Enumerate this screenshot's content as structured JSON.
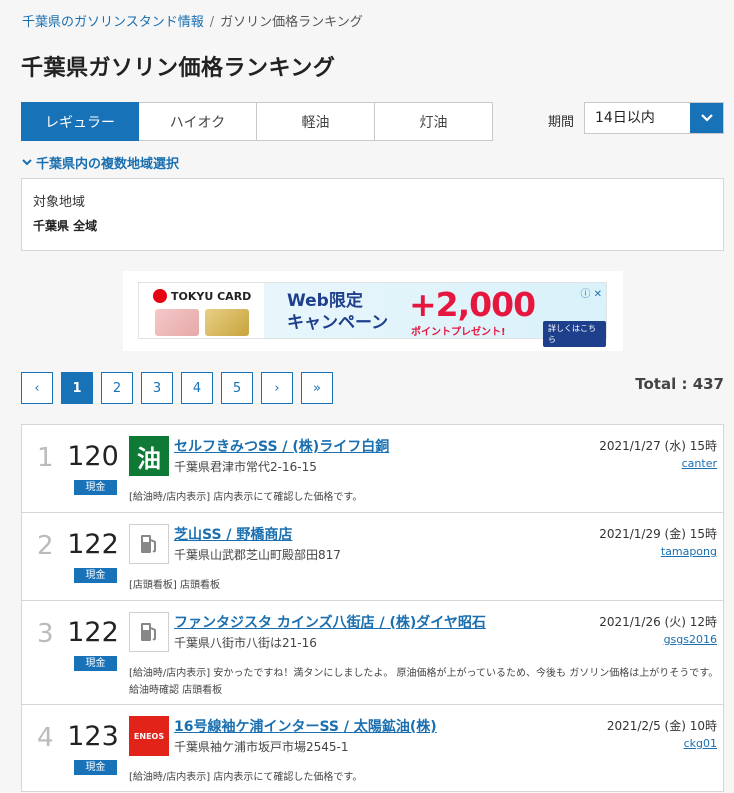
{
  "breadcrumb": {
    "parent": "千葉県のガソリンスタンド情報",
    "separator": "/",
    "current": "ガソリン価格ランキング"
  },
  "page_title": "千葉県ガソリン価格ランキング",
  "tabs": [
    {
      "label": "レギュラー",
      "active": true
    },
    {
      "label": "ハイオク",
      "active": false
    },
    {
      "label": "軽油",
      "active": false
    },
    {
      "label": "灯油",
      "active": false
    }
  ],
  "period": {
    "label": "期間",
    "value": "14日以内"
  },
  "region": {
    "toggle_label": "千葉県内の複数地域選択",
    "box_label": "対象地域",
    "value": "千葉県 全域"
  },
  "ad": {
    "brand": "TOKYU CARD",
    "headline_1": "Web限定",
    "headline_2": "キャンペーン",
    "amount": "+2,000",
    "present": "ポイントプレゼント!",
    "detail": "詳しくはこちら",
    "close": "ⓘ ✕"
  },
  "pager": {
    "prev": "‹",
    "pages": [
      "1",
      "2",
      "3",
      "4",
      "5"
    ],
    "next": "›",
    "last": "»",
    "current_page": 1
  },
  "total": "Total : 437",
  "colors": {
    "accent": "#1772b8",
    "link": "#1a6fb0",
    "eneos_red": "#e2231a"
  },
  "stations": [
    {
      "rank": "1",
      "price": "120",
      "payment": "現金",
      "logo": "abura-kanji-logo",
      "logo_text": "油",
      "name": "セルフきみつSS / (株)ライフ白銅",
      "address": "千葉県君津市常代2-16-15",
      "date": "2021/1/27 (水) 15時",
      "user": "canter",
      "note": "[給油時/店内表示] 店内表示にて確認した価格です。"
    },
    {
      "rank": "2",
      "price": "122",
      "payment": "現金",
      "logo": "fuel-pump-icon",
      "logo_text": "",
      "name": "芝山SS / 野橋商店",
      "address": "千葉県山武郡芝山町殿部田817",
      "date": "2021/1/29 (金) 15時",
      "user": "tamapong",
      "note": "[店頭看板] 店頭看板"
    },
    {
      "rank": "3",
      "price": "122",
      "payment": "現金",
      "logo": "fuel-pump-icon",
      "logo_text": "",
      "name": "ファンタジスタ カインズ八街店 / (株)ダイヤ昭石",
      "address": "千葉県八街市八街は21-16",
      "date": "2021/1/26 (火) 12時",
      "user": "gsgs2016",
      "note": "[給油時/店内表示] 安かったですね！満タンにしましたよ。 原油価格が上がっているため、今後も ガソリン価格は上がりそうです。 給油時確認 店頭看板"
    },
    {
      "rank": "4",
      "price": "123",
      "payment": "現金",
      "logo": "eneos-logo",
      "logo_text": "ENEOS",
      "name": "16号線袖ケ浦インターSS / 太陽鉱油(株)",
      "address": "千葉県袖ケ浦市坂戸市場2545-1",
      "date": "2021/2/5 (金) 10時",
      "user": "ckg01",
      "note": "[給油時/店内表示] 店内表示にて確認した価格です。"
    }
  ]
}
